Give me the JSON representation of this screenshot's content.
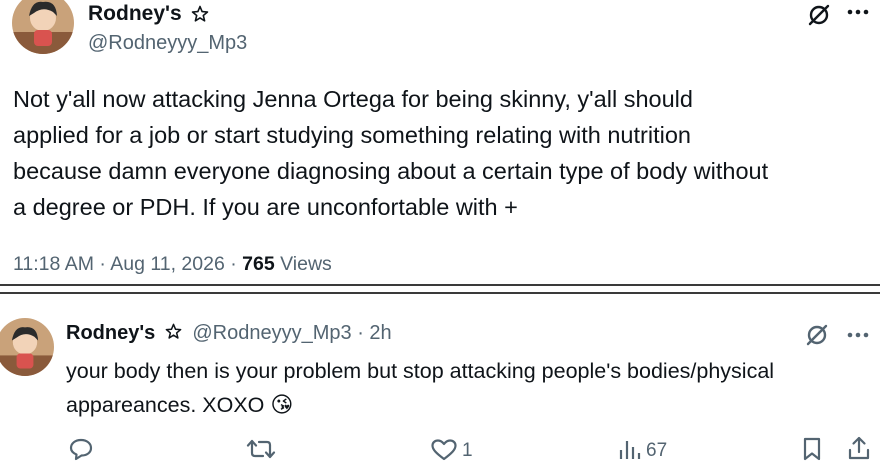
{
  "main_tweet": {
    "author_name": "Rodney's",
    "handle": "@Rodneyyy_Mp3",
    "text_lines": [
      "Not y'all now attacking Jenna Ortega for being skinny, y'all should",
      "applied for a job or start studying something relating with nutrition",
      "because damn everyone diagnosing about a certain type of body without",
      "a degree or PDH. If you are unconfortable with +"
    ],
    "time": "11:18 AM",
    "date": "Aug 11, 2026",
    "views_count": "765",
    "views_label": "Views",
    "dot": "·"
  },
  "reply_tweet": {
    "author_name": "Rodney's",
    "handle": "@Rodneyyy_Mp3",
    "age": "2h",
    "dot": "·",
    "text_lines": [
      "your body then is your problem but stop attacking people's bodies/physical",
      "appareances. XOXO"
    ],
    "emoji": "😘",
    "like_count": "1",
    "views_count": "67"
  },
  "colors": {
    "text": "#0f1419",
    "secondary": "#536471",
    "separator": "#3a3a3a"
  },
  "icons": [
    "star-badge-icon",
    "grok-icon",
    "more-icon",
    "reply-icon",
    "retweet-icon",
    "like-icon",
    "views-icon",
    "bookmark-icon",
    "share-icon"
  ]
}
